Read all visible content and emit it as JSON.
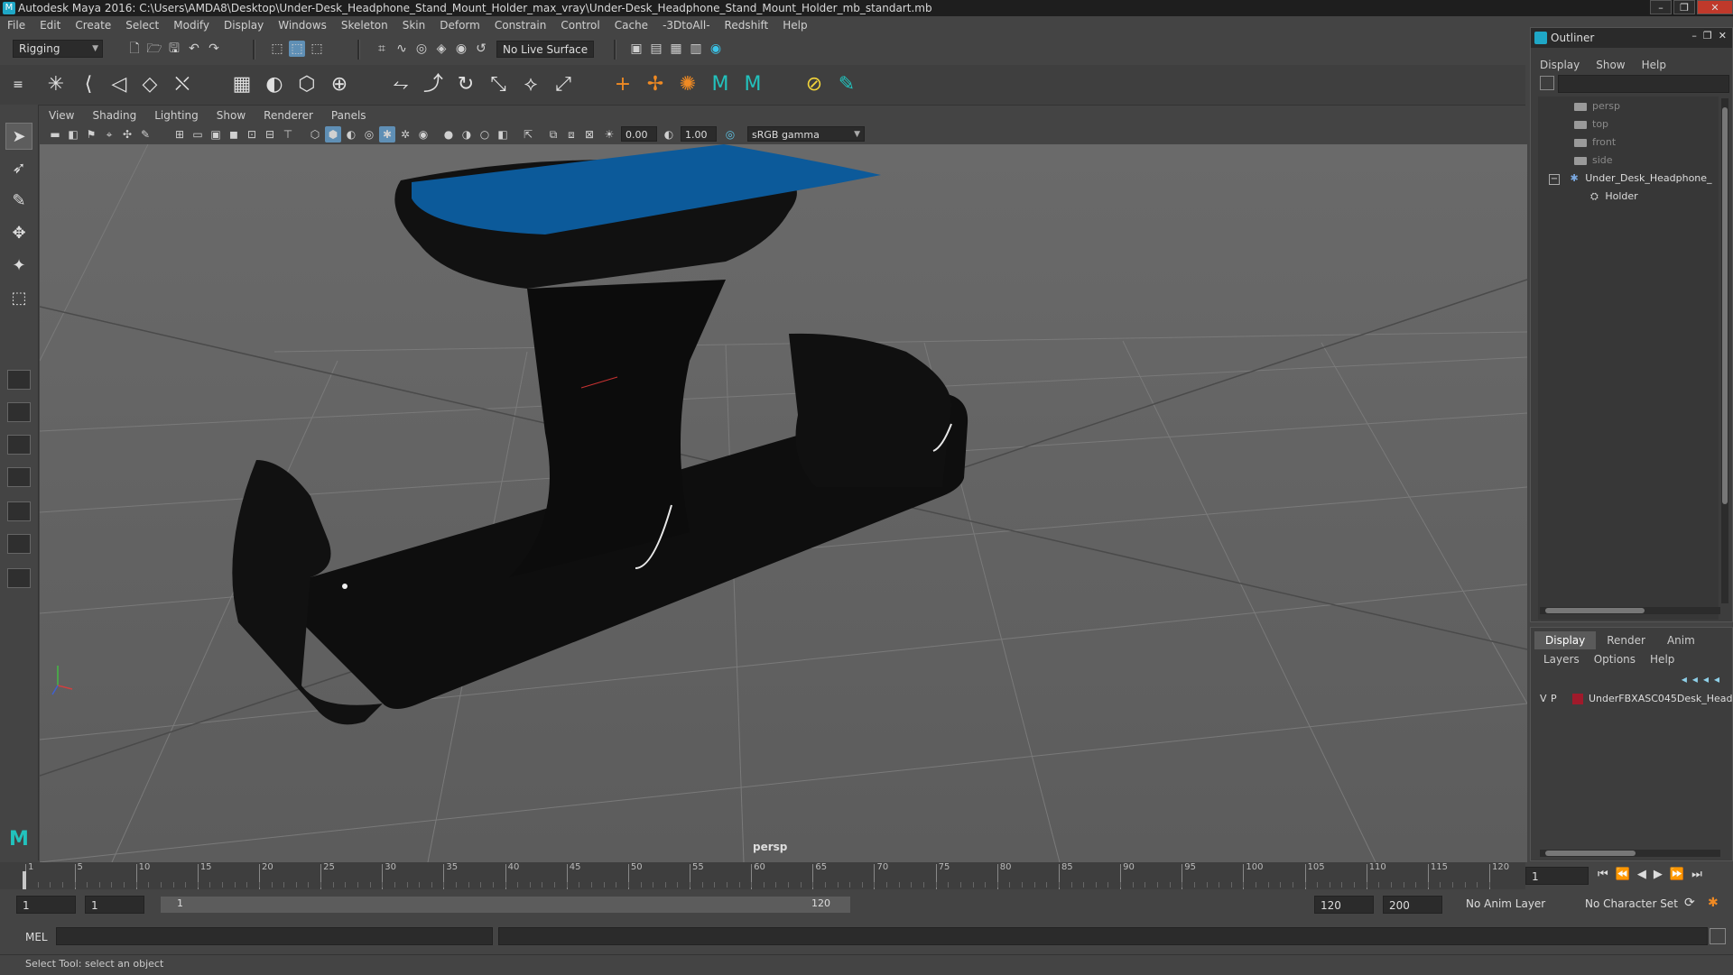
{
  "window": {
    "title": "Autodesk Maya 2016: C:\\Users\\AMDA8\\Desktop\\Under-Desk_Headphone_Stand_Mount_Holder_max_vray\\Under-Desk_Headphone_Stand_Mount_Holder_mb_standart.mb",
    "minimize": "–",
    "restore": "❐",
    "close": "✕"
  },
  "menubar": [
    "File",
    "Edit",
    "Create",
    "Select",
    "Modify",
    "Display",
    "Windows",
    "Skeleton",
    "Skin",
    "Deform",
    "Constrain",
    "Control",
    "Cache",
    "-3DtoAll-",
    "Redshift",
    "Help"
  ],
  "statusline": {
    "mode": "Rigging",
    "live_surface": "No Live Surface"
  },
  "panel": {
    "menus": [
      "View",
      "Shading",
      "Lighting",
      "Show",
      "Renderer",
      "Panels"
    ],
    "exposure": "0.00",
    "gamma": "1.00",
    "color_space": "sRGB gamma",
    "camera": "persp"
  },
  "outliner": {
    "title": "Outliner",
    "menus": [
      "Display",
      "Show",
      "Help"
    ],
    "items": [
      {
        "label": "persp",
        "expand": ""
      },
      {
        "label": "top",
        "expand": ""
      },
      {
        "label": "front",
        "expand": ""
      },
      {
        "label": "side",
        "expand": ""
      },
      {
        "label": "Under_Desk_Headphone_",
        "expand": "−"
      },
      {
        "label": "Holder",
        "expand": ""
      }
    ]
  },
  "layers": {
    "tabs": [
      "Display",
      "Render",
      "Anim"
    ],
    "menus": [
      "Layers",
      "Options",
      "Help"
    ],
    "row": {
      "v": "V",
      "p": "P",
      "name": "UnderFBXASC045Desk_Head",
      "color": "#a01a2b"
    }
  },
  "timeline": {
    "ticks": [
      1,
      5,
      10,
      15,
      20,
      25,
      30,
      35,
      40,
      45,
      50,
      55,
      60,
      65,
      70,
      75,
      80,
      85,
      90,
      95,
      100,
      105,
      110,
      115,
      120
    ],
    "current_frame": "1"
  },
  "range": {
    "start": "1",
    "playback_start": "1",
    "slider_start": "1",
    "slider_end": "120",
    "playback_end": "120",
    "end": "200",
    "anim_layer": "No Anim Layer",
    "character_set": "No Character Set"
  },
  "command": {
    "language": "MEL",
    "help": "Select Tool: select an object"
  },
  "colors": {
    "top_plate": "#0c5a9a",
    "body": "#0e0e0e",
    "layer_swatch": "#a01a2b"
  }
}
